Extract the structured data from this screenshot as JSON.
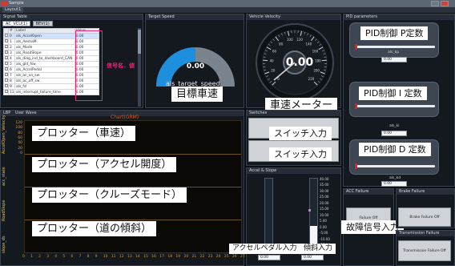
{
  "window": {
    "title": "Sample"
  },
  "menubar": {
    "tab": "Layout1"
  },
  "signal_table": {
    "panel_title": "Signal Table",
    "tabs": [
      "AC_VCU(1)",
      "BEV(1)"
    ],
    "headers": [
      "",
      "#",
      "Label",
      "Value"
    ],
    "rows": [
      {
        "n": "0",
        "label": "als_AccelOpen",
        "value": "0.00"
      },
      {
        "n": "1",
        "label": "als_AeshaM",
        "value": "0.00"
      },
      {
        "n": "2",
        "label": "als_Mode",
        "value": "0.00"
      },
      {
        "n": "3",
        "label": "als_RoadSlope",
        "value": "0.00"
      },
      {
        "n": "4",
        "label": "als_diag_ind_to_dashboard_CAN",
        "value": "0.00"
      },
      {
        "n": "5",
        "label": "als_gld_fsw",
        "value": "0.00"
      },
      {
        "n": "6",
        "label": "als_AccelPedal",
        "value": "0.00"
      },
      {
        "n": "7",
        "label": "als_ac_on_sw",
        "value": "0.00"
      },
      {
        "n": "8",
        "label": "als_ac_off_sw",
        "value": "0.00"
      },
      {
        "n": "9",
        "label": "als_fsl",
        "value": "0.00"
      },
      {
        "n": "11",
        "label": "als_interrupt_failure_time",
        "value": "0.00"
      }
    ],
    "annotation": "信号名、値"
  },
  "target_speed": {
    "panel_title": "Target Speed",
    "value": "0.00",
    "label": "als_target_speed",
    "callout": "目標車速",
    "level": 0.5
  },
  "vehicle_velocity": {
    "panel_title": "Vehicle Velocity",
    "value": "0.00",
    "dial_ticks": [
      "0",
      "20",
      "40",
      "60",
      "80",
      "100",
      "120",
      "140",
      "160",
      "180",
      "200",
      "220"
    ],
    "callout": "車速メーター"
  },
  "pid": {
    "panel_title": "PID parameters",
    "items": [
      {
        "callout": "PID制御 P定数",
        "label": "als_kp",
        "value": "0.00",
        "level": 0.0
      },
      {
        "callout": "PID制御 I 定数",
        "label": "als_ki",
        "value": "0.00",
        "level": 0.0
      },
      {
        "callout": "PID制御 D 定数",
        "label": "als_kd",
        "value": "0.00",
        "level": 0.0
      }
    ]
  },
  "plot": {
    "panel_title": "User Wave",
    "panel_prefix": "LBP",
    "chart_title": "Chart(GRM)",
    "series_labels": [
      "AccelOpen_Velocity",
      "acc_state",
      "RoadSlope",
      "slope_ds"
    ],
    "callouts": [
      "プロッター（車速）",
      "プロッター（アクセル開度）",
      "プロッター（クルーズモード）",
      "プロッター（道の傾斜）"
    ],
    "x_ticks": [
      "0",
      "1",
      "2",
      "3",
      "4",
      "5",
      "6",
      "7",
      "8",
      "9",
      "10",
      "11",
      "12",
      "13",
      "14",
      "15",
      "16",
      "17",
      "18",
      "19",
      "20",
      "21",
      "22",
      "23",
      "24",
      "25",
      "26",
      "27"
    ],
    "y_ticks": [
      "120",
      "100",
      "80",
      "60",
      "40",
      "20",
      "0"
    ]
  },
  "switches": {
    "panel_title": "Switches",
    "callouts": [
      "スイッチ入力",
      "スイッチ入力"
    ]
  },
  "accel_slope": {
    "panel_title": "Accel & Slope",
    "callouts": [
      "アクセルペダル入力",
      "傾斜入力"
    ],
    "accel": {
      "value": "0.00",
      "level": 0.0
    },
    "slope": {
      "value": "0.00",
      "level": 0.3
    },
    "scale": [
      "40.00",
      "35.00",
      "30.00",
      "25.00",
      "20.00",
      "15.00",
      "10.00",
      "5.00",
      "0.00",
      "-5.00",
      "-10.00",
      "-15.00"
    ]
  },
  "acc_failure": {
    "panel_title": "ACC Failure",
    "button": "Failure Off",
    "callout": "故障信号入力"
  },
  "brake_failure": {
    "panel_title": "Brake Failure",
    "button": "Brake Failure Off"
  },
  "transmission_failure": {
    "panel_title": "Transmission Failure",
    "button": "Transmission Failure Off"
  }
}
